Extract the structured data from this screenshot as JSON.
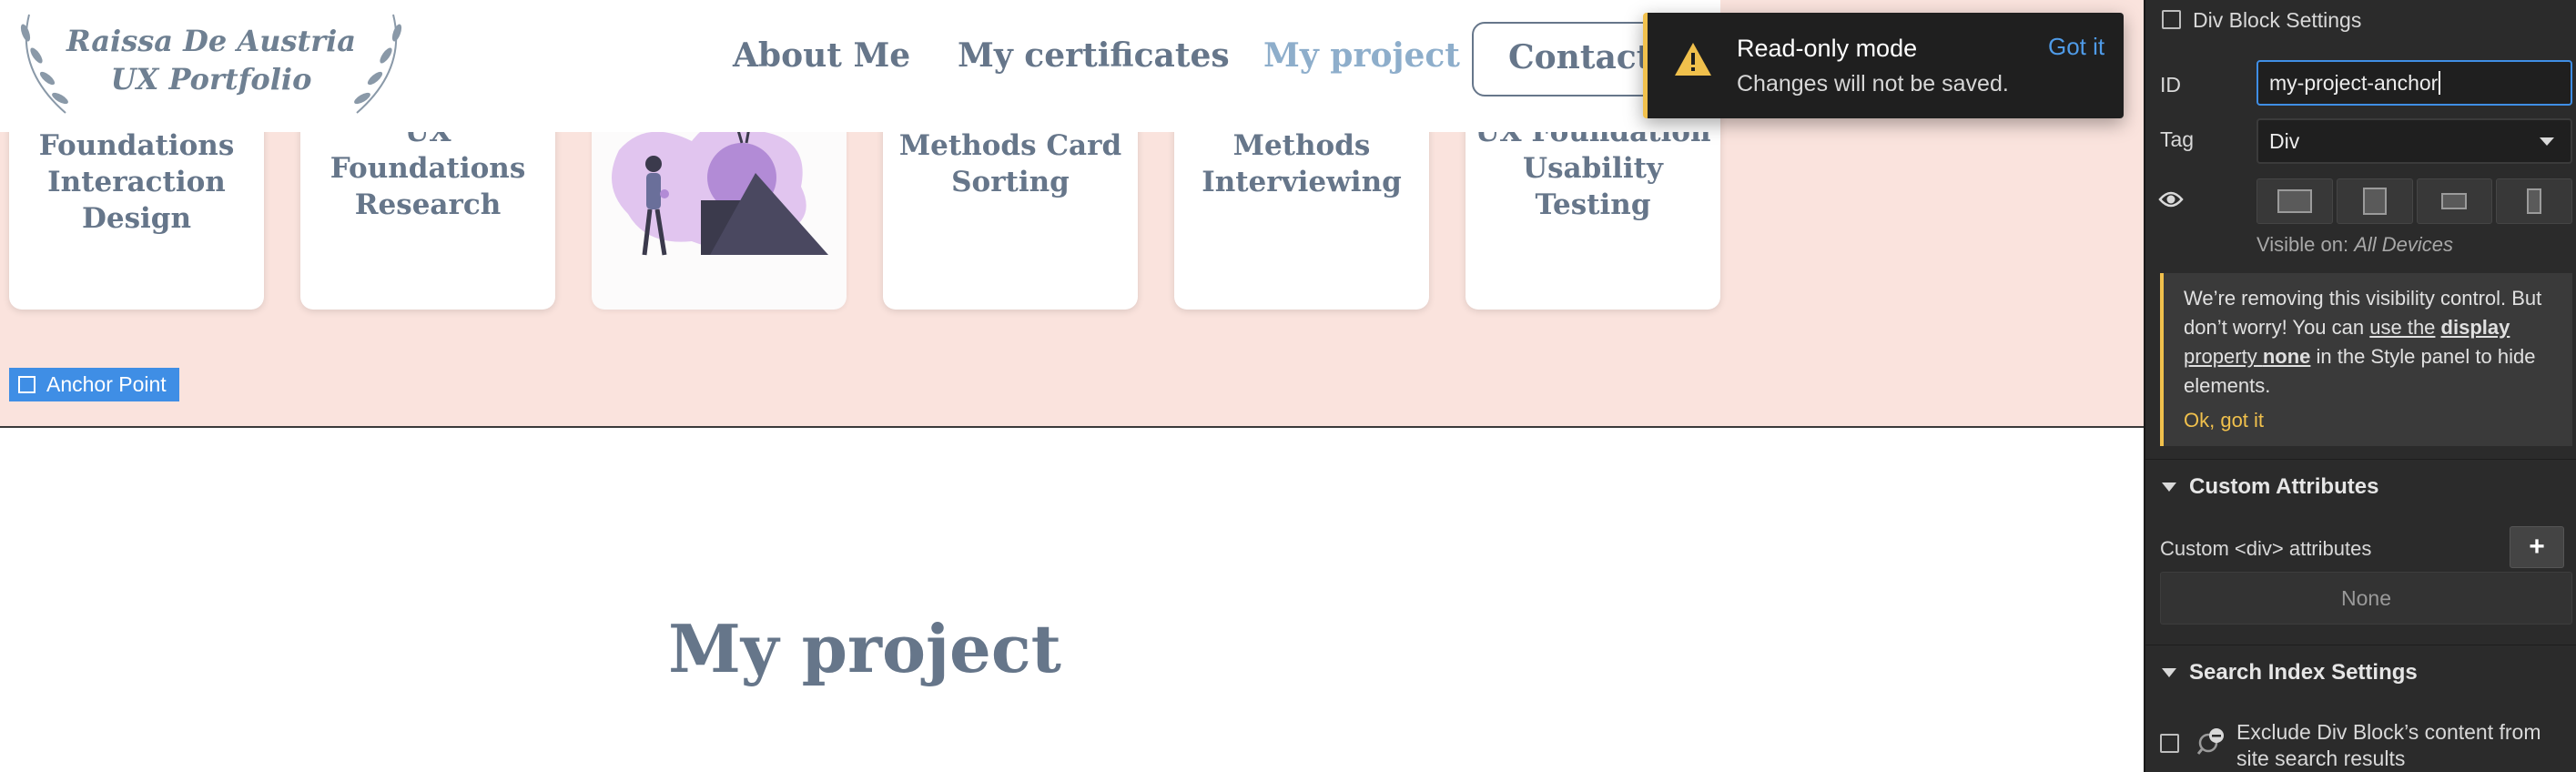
{
  "site": {
    "logo": {
      "line1": "Raissa De Austria",
      "line2": "UX Portfolio"
    },
    "nav": {
      "about": "About Me",
      "certificates": "My certificates",
      "project": "My project",
      "contact": "Contact me"
    },
    "cards": [
      {
        "title": "UX Foundations Interaction Design"
      },
      {
        "title": "UX Foundations Research"
      },
      {
        "title": ""
      },
      {
        "title": "UX Research Methods Card Sorting"
      },
      {
        "title": "UX Research Methods Interviewing"
      },
      {
        "title": "UX Foundation Usability Testing"
      }
    ],
    "anchor_badge": "Anchor Point",
    "section_title": "My project"
  },
  "toast": {
    "title": "Read-only mode",
    "body": "Changes will not be saved.",
    "action": "Got it"
  },
  "panel": {
    "header": "Div Block Settings",
    "id_label": "ID",
    "id_value": "my-project-anchor",
    "tag_label": "Tag",
    "tag_value": "Div",
    "visible_on_label": "Visible on:",
    "visible_on_value": "All Devices",
    "notice": {
      "text1": "We’re removing this visibility control. But don’t worry! You can ",
      "link1": "use the",
      "bold1": "display",
      "link2": " property ",
      "bold2": "none",
      "text2": " in the Style panel to hide elements.",
      "ok": "Ok, got it"
    },
    "custom_attrs": {
      "title": "Custom Attributes",
      "label": "Custom <div> attributes",
      "add": "+",
      "empty": "None"
    },
    "search_index": {
      "title": "Search Index Settings",
      "exclude_label": "Exclude Div Block’s content from site search results"
    }
  },
  "colors": {
    "pink_bg": "#fae3dd",
    "nav_text": "#66768a",
    "nav_active": "#8eaecb",
    "accent_blue": "#3f8ee5",
    "warning_yellow": "#f0c04c"
  }
}
